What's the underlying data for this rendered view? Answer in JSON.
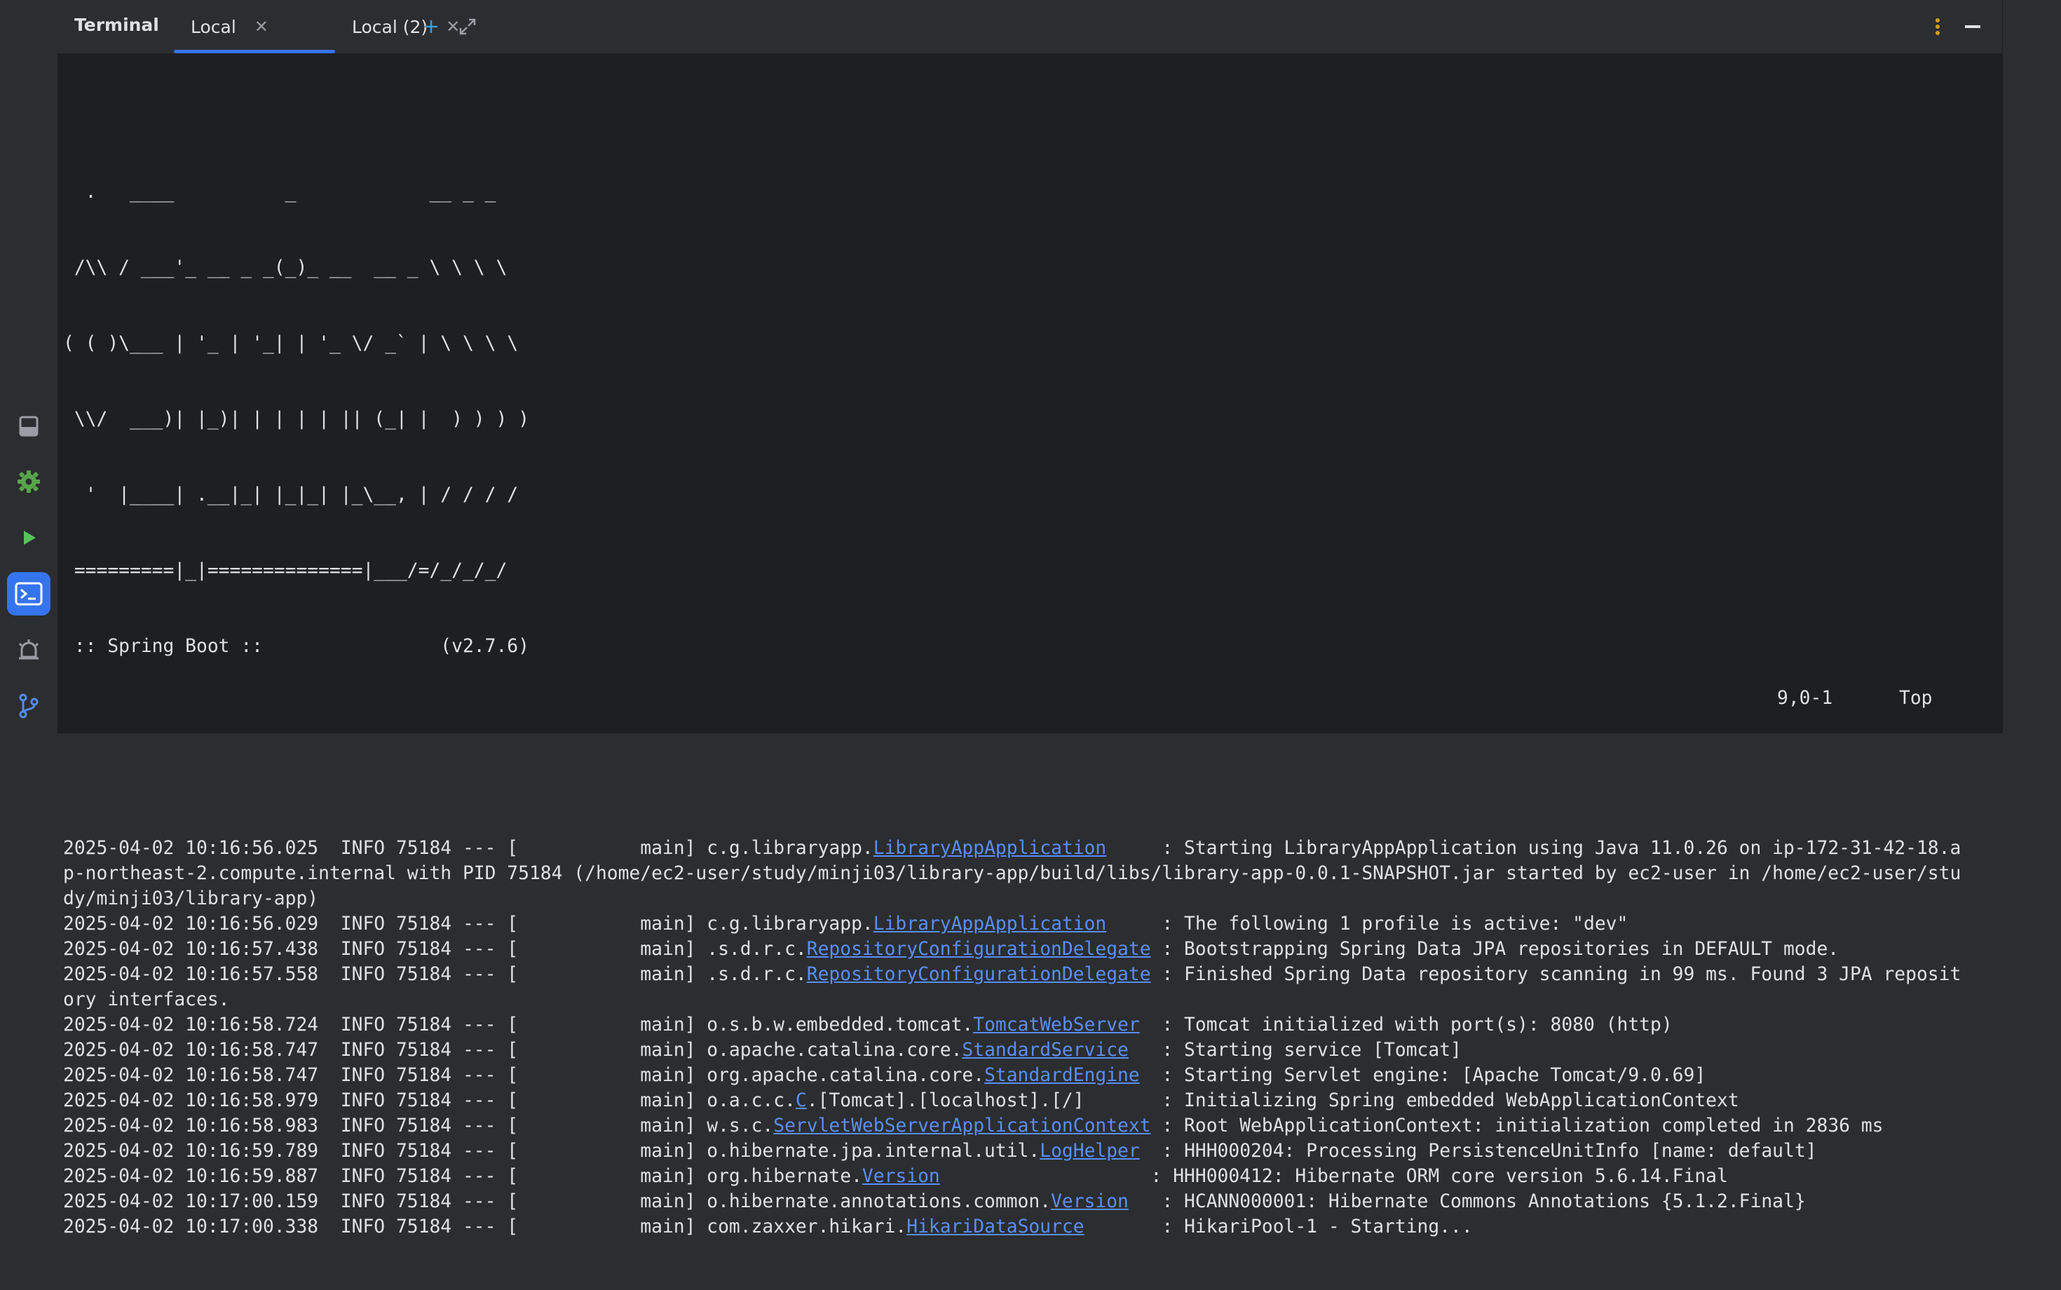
{
  "tool_window": {
    "title": "Terminal",
    "tabs": [
      {
        "label": "Local",
        "active": true
      },
      {
        "label": "Local (2)",
        "active": false
      }
    ],
    "icons": [
      "add-icon",
      "expand-icon",
      "more-options-icon",
      "minimize-icon"
    ]
  },
  "sidebar": {
    "icons": [
      "database-icon",
      "services-icon",
      "run-icon",
      "terminal-icon",
      "problems-icon",
      "git-icon"
    ],
    "active": "terminal-icon"
  },
  "banner": [
    "  .   ____          _            __ _ _",
    " /\\\\ / ___'_ __ _ _(_)_ __  __ _ \\ \\ \\ \\",
    "( ( )\\___ | '_ | '_| | '_ \\/ _` | \\ \\ \\ \\",
    " \\\\/  ___)| |_)| | | | | || (_| |  ) ) ) )",
    "  '  |____| .__|_| |_|_| |_\\__, | / / / /",
    " =========|_|==============|___/=/_/_/_/",
    " :: Spring Boot ::                (v2.7.6)"
  ],
  "log": [
    {
      "pre": "2025-04-02 10:16:56.025  INFO 75184 --- [           main] c.g.libraryapp.",
      "link": "LibraryAppApplication",
      "post": "     : Starting LibraryAppApplication using Java 11.0.26 on ip-172-31-42-18.a"
    },
    {
      "text": "p-northeast-2.compute.internal with PID 75184 (/home/ec2-user/study/minji03/library-app/build/libs/library-app-0.0.1-SNAPSHOT.jar started by ec2-user in /home/ec2-user/stu"
    },
    {
      "text": "dy/minji03/library-app)"
    },
    {
      "pre": "2025-04-02 10:16:56.029  INFO 75184 --- [           main] c.g.libraryapp.",
      "link": "LibraryAppApplication",
      "post": "     : The following 1 profile is active: \"dev\""
    },
    {
      "pre": "2025-04-02 10:16:57.438  INFO 75184 --- [           main] .s.d.r.c.",
      "link": "RepositoryConfigurationDelegate",
      "post": " : Bootstrapping Spring Data JPA repositories in DEFAULT mode."
    },
    {
      "pre": "2025-04-02 10:16:57.558  INFO 75184 --- [           main] .s.d.r.c.",
      "link": "RepositoryConfigurationDelegate",
      "post": " : Finished Spring Data repository scanning in 99 ms. Found 3 JPA reposit"
    },
    {
      "text": "ory interfaces."
    },
    {
      "pre": "2025-04-02 10:16:58.724  INFO 75184 --- [           main] o.s.b.w.embedded.tomcat.",
      "link": "TomcatWebServer",
      "post": "  : Tomcat initialized with port(s): 8080 (http)"
    },
    {
      "pre": "2025-04-02 10:16:58.747  INFO 75184 --- [           main] o.apache.catalina.core.",
      "link": "StandardService",
      "post": "   : Starting service [Tomcat]"
    },
    {
      "pre": "2025-04-02 10:16:58.747  INFO 75184 --- [           main] org.apache.catalina.core.",
      "link": "StandardEngine",
      "post": "  : Starting Servlet engine: [Apache Tomcat/9.0.69]"
    },
    {
      "pre": "2025-04-02 10:16:58.979  INFO 75184 --- [           main] o.a.c.c.",
      "link": "C",
      "post": ".[Tomcat].[localhost].[/]       : Initializing Spring embedded WebApplicationContext"
    },
    {
      "pre": "2025-04-02 10:16:58.983  INFO 75184 --- [           main] w.s.c.",
      "link": "ServletWebServerApplicationContext",
      "post": " : Root WebApplicationContext: initialization completed in 2836 ms"
    },
    {
      "pre": "2025-04-02 10:16:59.789  INFO 75184 --- [           main] o.hibernate.jpa.internal.util.",
      "link": "LogHelper",
      "post": "  : HHH000204: Processing PersistenceUnitInfo [name: default]"
    },
    {
      "pre": "2025-04-02 10:16:59.887  INFO 75184 --- [           main] org.hibernate.",
      "link": "Version",
      "post": "                   : HHH000412: Hibernate ORM core version 5.6.14.Final"
    },
    {
      "pre": "2025-04-02 10:17:00.159  INFO 75184 --- [           main] o.hibernate.annotations.common.",
      "link": "Version",
      "post": "   : HCANN000001: Hibernate Commons Annotations {5.1.2.Final}"
    },
    {
      "pre": "2025-04-02 10:17:00.338  INFO 75184 --- [           main] com.zaxxer.hikari.",
      "link": "HikariDataSource",
      "post": "       : HikariPool-1 - Starting..."
    }
  ],
  "status": {
    "position": "9,0-1",
    "scroll": "Top"
  },
  "colors": {
    "link": "#5a8ef5",
    "accent": "#3574f0",
    "background": "#1e1f22",
    "chrome": "#2b2d30"
  }
}
